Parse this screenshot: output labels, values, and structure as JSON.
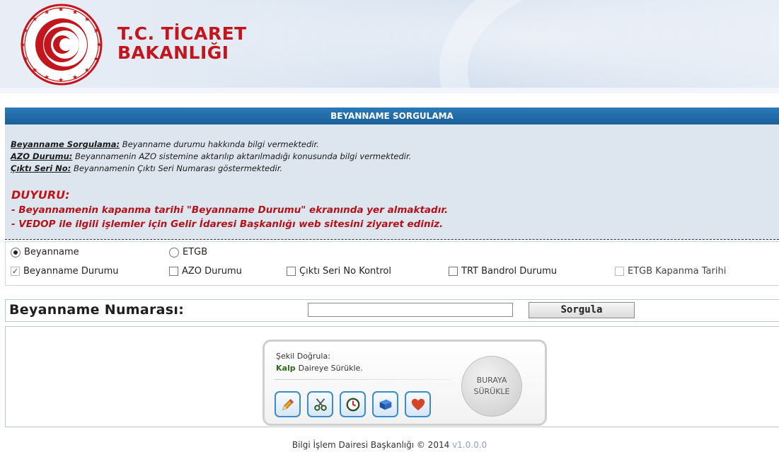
{
  "header": {
    "brand_line1": "T.C. TİCARET",
    "brand_line2": "BAKANLIĞI",
    "brand_color": "#c3151c"
  },
  "title_bar": {
    "title": "BEYANNAME SORGULAMA"
  },
  "info": {
    "items": [
      {
        "term": "Beyanname Sorgulama:",
        "desc": " Beyanname durumu hakkında bilgi vermektedir."
      },
      {
        "term": "AZO Durumu:",
        "desc": " Beyannamenin AZO sistemine aktarılıp aktarılmadığı konusunda bilgi vermektedir."
      },
      {
        "term": "Çıktı Seri No:",
        "desc": " Beyannamenin Çıktı Seri Numarası göstermektedir."
      }
    ],
    "announcement_title": "DUYURU:",
    "announcements": [
      "- Beyannamenin kapanma tarihi \"Beyanname Durumu\" ekranında yer almaktadır.",
      "- VEDOP ile ilgili işlemler için Gelir İdaresi Başkanlığı web sitesini ziyaret ediniz."
    ]
  },
  "options": {
    "radios": [
      {
        "label": "Beyanname",
        "selected": true
      },
      {
        "label": "ETGB",
        "selected": false
      }
    ],
    "checkboxes": [
      {
        "label": "Beyanname Durumu",
        "checked": true,
        "disabled": true
      },
      {
        "label": "AZO Durumu",
        "checked": false,
        "disabled": false
      },
      {
        "label": "Çıktı Seri No Kontrol",
        "checked": false,
        "disabled": false
      },
      {
        "label": "TRT Bandrol Durumu",
        "checked": false,
        "disabled": false
      },
      {
        "label": "ETGB Kapanma Tarihi",
        "checked": false,
        "disabled": true
      }
    ]
  },
  "search": {
    "label": "Beyanname Numarası:",
    "value": "",
    "button_label": "Sorgula"
  },
  "captcha": {
    "instruction": "Şekil Doğrula:",
    "target_word": "Kalp",
    "target_text": "Daireye Sürükle.",
    "drop_line1": "BURAYA",
    "drop_line2": "SÜRÜKLE",
    "icons": [
      "pencil-icon",
      "scissors-icon",
      "clock-icon",
      "book-icon",
      "heart-icon"
    ]
  },
  "footer": {
    "text": "Bilgi İşlem Dairesi Başkanlığı © 2014",
    "version": "v1.0.0.0"
  }
}
